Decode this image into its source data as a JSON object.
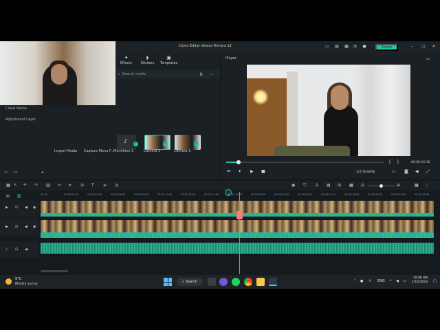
{
  "window": {
    "title": "Cómo Editar Videos Filmora 12",
    "export_label": "Export"
  },
  "library": {
    "nav": [
      {
        "label": "Effects",
        "icon": "effects-icon"
      },
      {
        "label": "Stickers",
        "icon": "stickers-icon"
      },
      {
        "label": "Templates",
        "icon": "templates-icon"
      }
    ],
    "search_placeholder": "Search media",
    "sidebar_items": [
      "Cloud Media",
      "Adjustment Layer"
    ],
    "media": [
      {
        "label": "Import Media"
      },
      {
        "label": "Captura Menu F..."
      },
      {
        "label": "Micrófono 1"
      },
      {
        "label": "Cámara 2"
      },
      {
        "label": "Cámara 1"
      }
    ]
  },
  "player": {
    "label": "Player",
    "time": "00:00:16:16",
    "quality": "1/2 Quality",
    "progress": 0.08
  },
  "timeline": {
    "ruler": [
      "00:00",
      "00:00:02:00",
      "00:00:04:00",
      "00:00:06:00",
      "00:00:08:00",
      "00:00:10:00",
      "00:00:12:00",
      "00:00:14:00",
      "00:00:16:00",
      "00:00:18:00",
      "00:00:20:00",
      "00:00:22:00",
      "00:00:24:00",
      "00:00:26:00",
      "00:00:28:00",
      "00:00:30:00",
      "00:00:32:00"
    ]
  },
  "taskbar": {
    "temp": "9°C",
    "weather": "Mostly sunny",
    "search": "Search",
    "lang": "ENG",
    "time": "10:06 AM",
    "date": "1/12/2023"
  }
}
